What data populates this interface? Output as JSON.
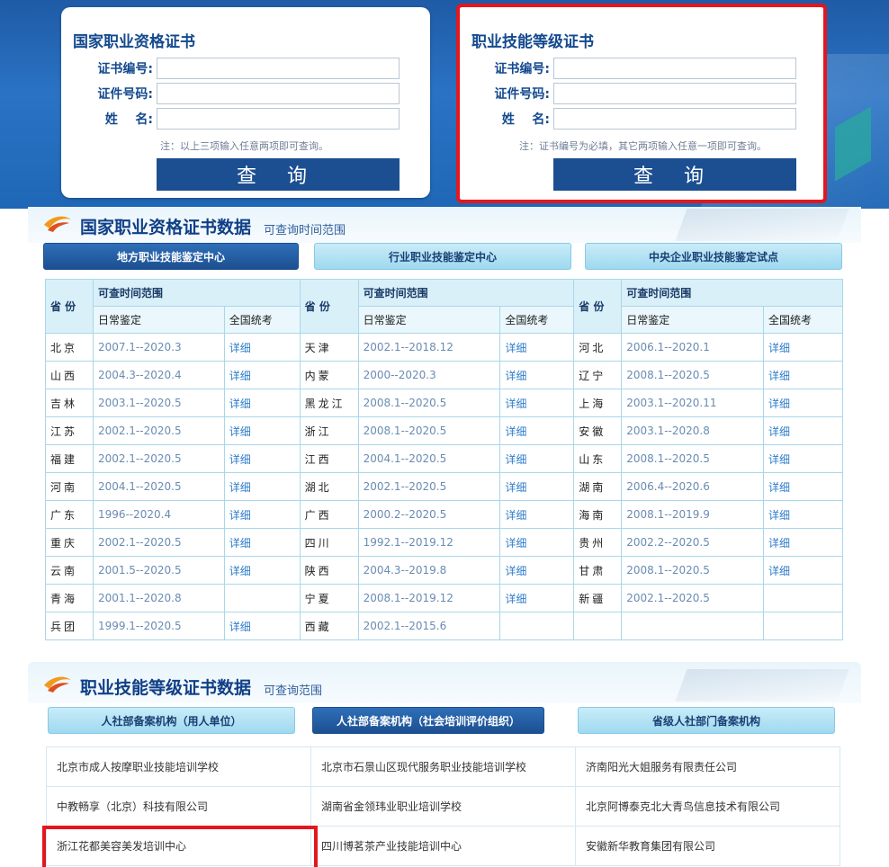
{
  "query_left": {
    "title": "国家职业资格证书",
    "labels": [
      "证书编号:",
      "证件号码:",
      "姓    名:"
    ],
    "note": "注：以上三项输入任意两项即可查询。",
    "button": "查 询"
  },
  "query_right": {
    "title": "职业技能等级证书",
    "labels": [
      "证书编号:",
      "证件号码:",
      "姓    名:"
    ],
    "note": "注：证书编号为必填，其它两项输入任意一项即可查询。",
    "button": "查 询"
  },
  "section1": {
    "title": "国家职业资格证书数据",
    "subtitle": "可查询时间范围",
    "tabs": [
      "地方职业技能鉴定中心",
      "行业职业技能鉴定中心",
      "中央企业职业技能鉴定试点"
    ],
    "header": {
      "province": "省 份",
      "range": "可查时间范围",
      "daily": "日常鉴定",
      "national": "全国统考"
    },
    "rows": [
      [
        [
          "北京",
          "2007.1--2020.3",
          "详细"
        ],
        [
          "天津",
          "2002.1--2018.12",
          "详细"
        ],
        [
          "河北",
          "2006.1--2020.1",
          "详细"
        ]
      ],
      [
        [
          "山西",
          "2004.3--2020.4",
          "详细"
        ],
        [
          "内蒙",
          "2000--2020.3",
          "详细"
        ],
        [
          "辽宁",
          "2008.1--2020.5",
          "详细"
        ]
      ],
      [
        [
          "吉林",
          "2003.1--2020.5",
          "详细"
        ],
        [
          "黑龙江",
          "2008.1--2020.5",
          "详细"
        ],
        [
          "上海",
          "2003.1--2020.11",
          "详细"
        ]
      ],
      [
        [
          "江苏",
          "2002.1--2020.5",
          "详细"
        ],
        [
          "浙江",
          "2008.1--2020.5",
          "详细"
        ],
        [
          "安徽",
          "2003.1--2020.8",
          "详细"
        ]
      ],
      [
        [
          "福建",
          "2002.1--2020.5",
          "详细"
        ],
        [
          "江西",
          "2004.1--2020.5",
          "详细"
        ],
        [
          "山东",
          "2008.1--2020.5",
          "详细"
        ]
      ],
      [
        [
          "河南",
          "2004.1--2020.5",
          "详细"
        ],
        [
          "湖北",
          "2002.1--2020.5",
          "详细"
        ],
        [
          "湖南",
          "2006.4--2020.6",
          "详细"
        ]
      ],
      [
        [
          "广东",
          "1996--2020.4",
          "详细"
        ],
        [
          "广西",
          "2000.2--2020.5",
          "详细"
        ],
        [
          "海南",
          "2008.1--2019.9",
          "详细"
        ]
      ],
      [
        [
          "重庆",
          "2002.1--2020.5",
          "详细"
        ],
        [
          "四川",
          "1992.1--2019.12",
          "详细"
        ],
        [
          "贵州",
          "2002.2--2020.5",
          "详细"
        ]
      ],
      [
        [
          "云南",
          "2001.5--2020.5",
          "详细"
        ],
        [
          "陕西",
          "2004.3--2019.8",
          "详细"
        ],
        [
          "甘肃",
          "2008.1--2020.5",
          "详细"
        ]
      ],
      [
        [
          "青海",
          "2001.1--2020.8",
          ""
        ],
        [
          "宁夏",
          "2008.1--2019.12",
          "详细"
        ],
        [
          "新疆",
          "2002.1--2020.5",
          ""
        ]
      ],
      [
        [
          "兵团",
          "1999.1--2020.5",
          "详细"
        ],
        [
          "西藏",
          "2002.1--2015.6",
          ""
        ],
        [
          "",
          "",
          ""
        ]
      ]
    ]
  },
  "section2": {
    "title": "职业技能等级证书数据",
    "subtitle": "可查询范围",
    "tabs": [
      "人社部备案机构（用人单位）",
      "人社部备案机构（社会培训评价组织）",
      "省级人社部门备案机构"
    ],
    "orgs": [
      [
        "北京市成人按摩职业技能培训学校",
        "北京市石景山区现代服务职业技能培训学校",
        "济南阳光大姐服务有限责任公司"
      ],
      [
        "中教畅享（北京）科技有限公司",
        "湖南省金领玮业职业培训学校",
        "北京阿博泰克北大青鸟信息技术有限公司"
      ],
      [
        "浙江花都美容美发培训中心",
        "四川博茗茶产业技能培训中心",
        "安徽新华教育集团有限公司"
      ]
    ]
  }
}
